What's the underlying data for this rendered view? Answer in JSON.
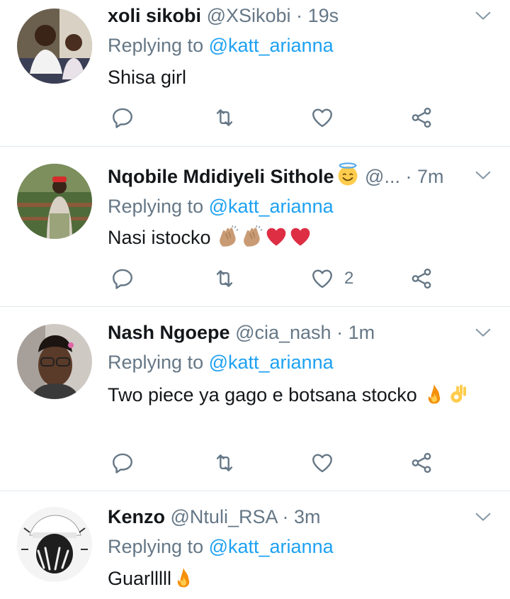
{
  "tweets": [
    {
      "name": "xoli sikobi",
      "handle": "@XSikobi",
      "dot": "·",
      "time": "19s",
      "replying_prefix": "Replying to ",
      "replying_to": "@katt_arianna",
      "text": "Shisa girl",
      "like_count": ""
    },
    {
      "name": "Nqobile Mdidiyeli Sithole",
      "handle": "@...",
      "dot": "·",
      "time": "7m",
      "replying_prefix": "Replying to ",
      "replying_to": "@katt_arianna",
      "text": "Nasi istocko ",
      "like_count": "2"
    },
    {
      "name": "Nash Ngoepe",
      "handle": "@cia_nash",
      "dot": "·",
      "time": "1m",
      "replying_prefix": "Replying to ",
      "replying_to": "@katt_arianna",
      "text": "Two piece ya gago e botsana  stocko ",
      "like_count": ""
    },
    {
      "name": "Kenzo",
      "handle": "@Ntuli_RSA",
      "dot": "·",
      "time": "3m",
      "replying_prefix": "Replying to ",
      "replying_to": "@katt_arianna",
      "text": "Guarlllll",
      "like_count": ""
    }
  ],
  "icons": {
    "reply": "reply-icon",
    "retweet": "retweet-icon",
    "like": "heart-icon",
    "share": "share-icon",
    "caret": "chevron-down-icon"
  },
  "colors": {
    "link": "#1da1f2",
    "secondary": "#657786",
    "divider": "#e1e8ed",
    "heart_emoji": "#dd2e44",
    "fire_emoji": "#f4900c"
  }
}
